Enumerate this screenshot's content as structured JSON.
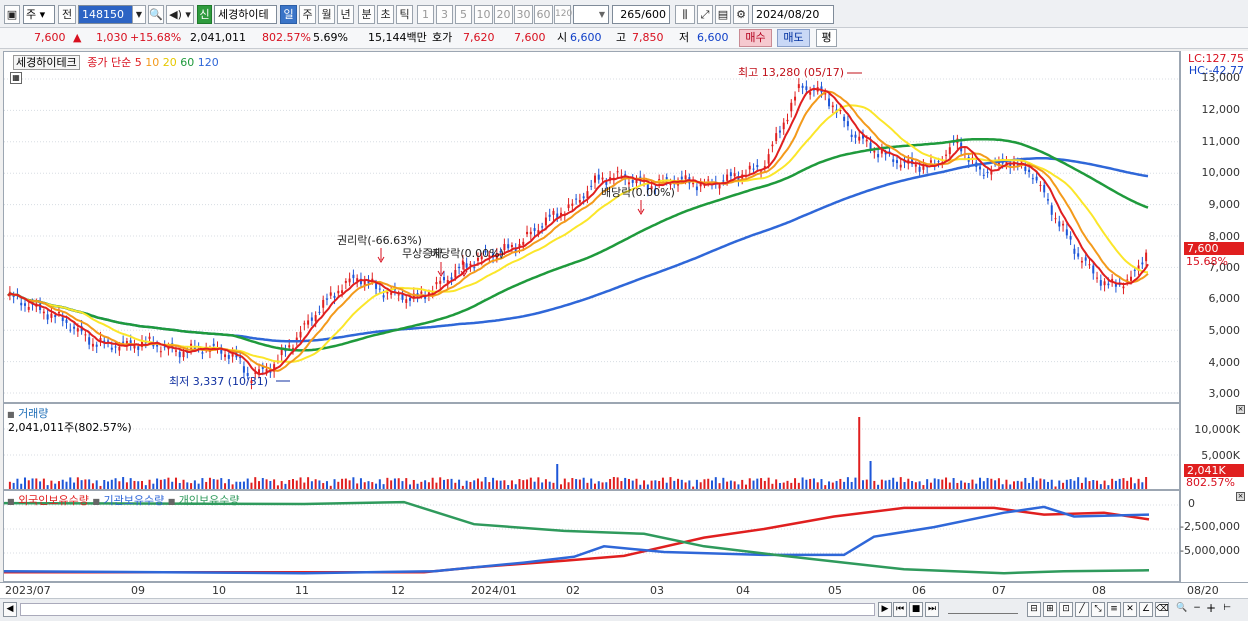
{
  "toolbar": {
    "market": "주",
    "prev_label": "전",
    "code": "148150",
    "tag_new": "신",
    "stock_name": "세경하이테",
    "periods": [
      "일",
      "주",
      "월",
      "년",
      "분",
      "초",
      "틱"
    ],
    "intervals": [
      "1",
      "3",
      "5",
      "10",
      "20",
      "30",
      "60",
      "120"
    ],
    "count": "265",
    "count_total": "/600",
    "date": "2024/08/20"
  },
  "quote": {
    "price": "7,600",
    "arrow": "▲",
    "change": "1,030",
    "change_pct": "+15.68%",
    "volume": "2,041,011",
    "volume_ratio": "802.57%",
    "turnover": "5.69%",
    "amount": "15,144백만",
    "ask_label": "호가",
    "ask": "7,620",
    "bid": "7,600",
    "open_label": "시",
    "open": "6,600",
    "high_label": "고",
    "high": "7,850",
    "low_label": "저",
    "low": "6,600",
    "buy_label": "매수",
    "sell_label": "매도",
    "eval_label": "평"
  },
  "price_pane": {
    "title": "세경하이테크",
    "ma_label": "종가 단순",
    "ma_periods": [
      "5",
      "10",
      "20",
      "60",
      "120"
    ],
    "lc": "LC:127.75",
    "hc": "HC:-42.77",
    "high_annot": "최고 13,280 (05/17)",
    "low_annot": "최저 3,337 (10/31)",
    "event_rights": "권리락(-66.63%)",
    "event_bonus": "무상증자",
    "event_dividend1": "배당락(0.00%)",
    "event_dividend2": "배당락(0.00%)",
    "current_tag": "7,600",
    "current_pct": "15.68%",
    "y_labels": [
      "13,000",
      "12,000",
      "11,000",
      "10,000",
      "9,000",
      "8,000",
      "7,000",
      "6,000",
      "5,000",
      "4,000",
      "3,000"
    ]
  },
  "volume_pane": {
    "title": "거래량",
    "value_text": "2,041,011주(802.57%)",
    "y_labels": [
      "10,000K",
      "5,000K"
    ],
    "current_tag": "2,041K",
    "current_pct": "802.57%"
  },
  "holding_pane": {
    "legend": [
      "외국인보유수량",
      "기관보유수량",
      "개인보유수량"
    ],
    "y_labels": [
      "0",
      "-2,500,000",
      "-5,000,000"
    ]
  },
  "x_labels": [
    "2023/07",
    "09",
    "10",
    "11",
    "12",
    "2024/01",
    "02",
    "03",
    "04",
    "05",
    "06",
    "07",
    "08",
    "08/20"
  ],
  "colors": {
    "up": "#e01f1f",
    "down": "#1d56d8",
    "ma5": "#e01f1f",
    "ma10": "#f39a1b",
    "ma20": "#fbe62a",
    "ma60": "#1f9a3c",
    "ma120": "#2f67d8",
    "foreign": "#e01f1f",
    "institution": "#2f67d8",
    "individual": "#2f9a5c"
  }
}
